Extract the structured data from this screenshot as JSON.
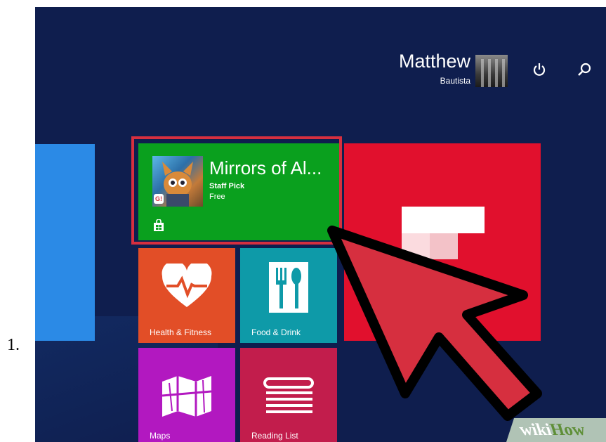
{
  "step": {
    "number": "1."
  },
  "user": {
    "first_name": "Matthew",
    "last_name": "Bautista"
  },
  "header_icons": {
    "power": "power-icon",
    "search": "search-icon"
  },
  "featured_tile": {
    "title": "Mirrors of Al...",
    "subtitle": "Staff Pick",
    "price": "Free",
    "badge_text": "G!",
    "store_icon": "store-icon",
    "color": "#0aa01e",
    "highlight_color": "#d62f3f"
  },
  "tiles": {
    "health": {
      "label": "Health & Fitness",
      "icon": "heart-pulse-icon",
      "color": "#e24e27"
    },
    "food": {
      "label": "Food & Drink",
      "icon": "fork-knife-icon",
      "color": "#0e9aa8"
    },
    "maps": {
      "label": "Maps",
      "icon": "map-icon",
      "color": "#b218c0"
    },
    "reading": {
      "label": "Reading List",
      "icon": "reading-list-icon",
      "color": "#c21d4c"
    },
    "flipboard": {
      "icon": "flipboard-icon",
      "color": "#e1102d"
    }
  },
  "watermark": {
    "part1": "wiki",
    "part2": "How"
  }
}
